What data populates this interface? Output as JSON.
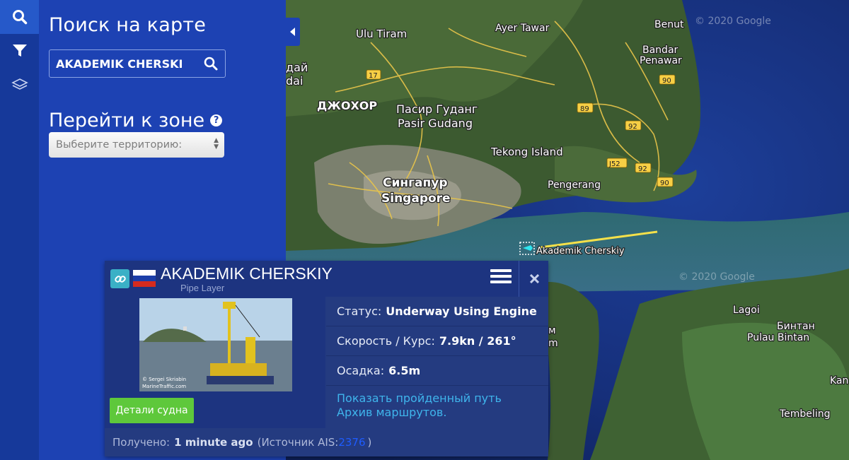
{
  "toolbar": {
    "items": [
      {
        "icon": "search-icon",
        "active": true
      },
      {
        "icon": "filter-icon",
        "active": false
      },
      {
        "icon": "layers-icon",
        "active": false
      }
    ]
  },
  "search_panel": {
    "title": "Поиск на карте",
    "search_value": "AKADEMIK CHERSKI",
    "zone_title": "Перейти к зоне",
    "help": "?",
    "select_placeholder": "Выберите территорию:"
  },
  "map": {
    "watermarks": [
      "© 2020 Google",
      "© 2020 Google"
    ],
    "labels": {
      "ulu_tiram": "Ulu Tiram",
      "ayer_tawar": "Ayer Tawar",
      "benut": "Benut",
      "bandar_penawar_1": "Bandar",
      "bandar_penawar_2": "Penawar",
      "partial_1": "дай",
      "partial_2": "dai",
      "johor": "ДЖОХОР",
      "pasir_gudang_ru": "Пасир Гуданг",
      "pasir_gudang": "Pasir Gudang",
      "tekong": "Tekong Island",
      "pengerang": "Pengerang",
      "singapore_ru": "Сингапур",
      "singapore": "Singapore",
      "vessel": "Akademik Cherskiy",
      "lagoi": "Lagoi",
      "bintan_ru": "Бинтан",
      "bintan": "Pulau Bintan",
      "kan": "Kan",
      "tembeling": "Tembeling",
      "partial_m": "м",
      "partial_m2": "m"
    },
    "road_shields": [
      "17",
      "90",
      "89",
      "92",
      "J52",
      "92",
      "90"
    ]
  },
  "popup": {
    "name": "AKADEMIK CHERSKIY",
    "type": "Pipe Layer",
    "photo_credit_1": "© Sergei Skriabin",
    "photo_credit_2": "MarineTraffic.com",
    "details_button": "Детали судна",
    "status_label": "Статус:",
    "status_value": "Underway Using Engine",
    "speed_label": "Скорость / Курс:",
    "speed_value": "7.9kn / 261°",
    "draught_label": "Осадка:",
    "draught_value": "6.5m",
    "link_track": "Показать пройденный путь",
    "link_archive": "Архив маршрутов.",
    "received_label": "Получено:",
    "received_value": "1 minute ago",
    "source_label": "(Источник AIS:",
    "source_id": "2376",
    "source_close": ")"
  },
  "colors": {
    "toolbar": "#16399a",
    "panel": "#1d42b3",
    "popup": "#243b80",
    "details_button": "#5ec83b",
    "link": "#3fb5ec",
    "vessel_track": "#f4e04a"
  }
}
